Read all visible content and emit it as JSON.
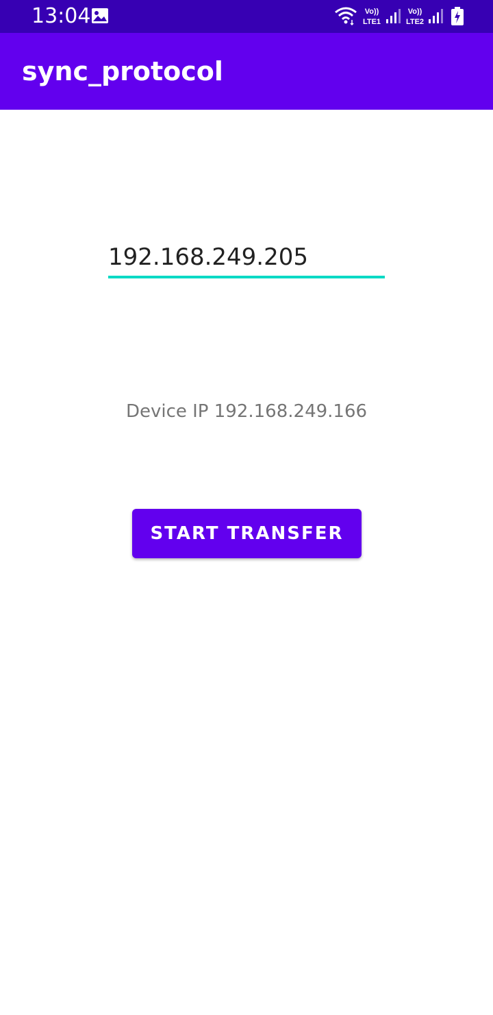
{
  "status_bar": {
    "time": "13:04",
    "icons": [
      "gallery-icon",
      "wifi-icon",
      "volte-lte1-icon",
      "signal-icon",
      "volte-lte2-icon",
      "signal-icon",
      "battery-charging-icon"
    ],
    "lte1_label": "LTE1",
    "lte2_label": "LTE2",
    "volte_label": "Vo))",
    "color": "#3700B3"
  },
  "app_bar": {
    "title": "sync_protocol",
    "color": "#6200EE"
  },
  "main": {
    "ip_input_value": "192.168.249.205",
    "device_ip_text": "Device IP 192.168.249.166",
    "start_button_label": "START TRANSFER",
    "accent_color": "#03DAC5"
  }
}
